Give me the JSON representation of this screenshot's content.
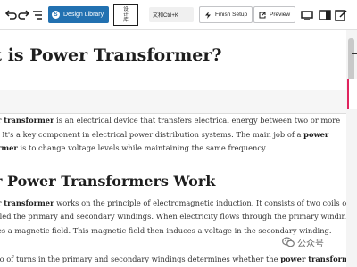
{
  "toolbar": {
    "design_library_label": "Design Library",
    "design_library_icon": "S",
    "language_box_text": "设\n计\n库",
    "search_shortcut": "文和Ctrl+K",
    "finish_setup_label": "Finish Setup",
    "preview_label": "Preview",
    "accent_color": "#2271b1"
  },
  "article": {
    "title": "at is Power Transformer?",
    "intro": {
      "line1_bold": "r transformer",
      "line1_rest": " is an electrical device that transfers electrical energy between two or more",
      "line2": ". It's a key component in electrical power distribution systems. The main job of a ",
      "line2_bold": "power",
      "line3_bold": "rmer",
      "line3_rest": " is to change voltage levels while maintaining the same frequency."
    },
    "section_heading": "r Power Transformers Work",
    "how": {
      "line1_bold": "r transformer",
      "line1_rest": " works on the principle of electromagnetic induction. It consists of two coils of",
      "line2": "iled the primary and secondary windings. When electricity flows through the primary winding,",
      "line3": "es a magnetic field. This magnetic field then induces a voltage in the secondary winding.",
      "line4": "io of turns in the primary and secondary windings determines whether the ",
      "line4_bold": "power transformer"
    }
  },
  "watermark": {
    "text": "公众号"
  }
}
